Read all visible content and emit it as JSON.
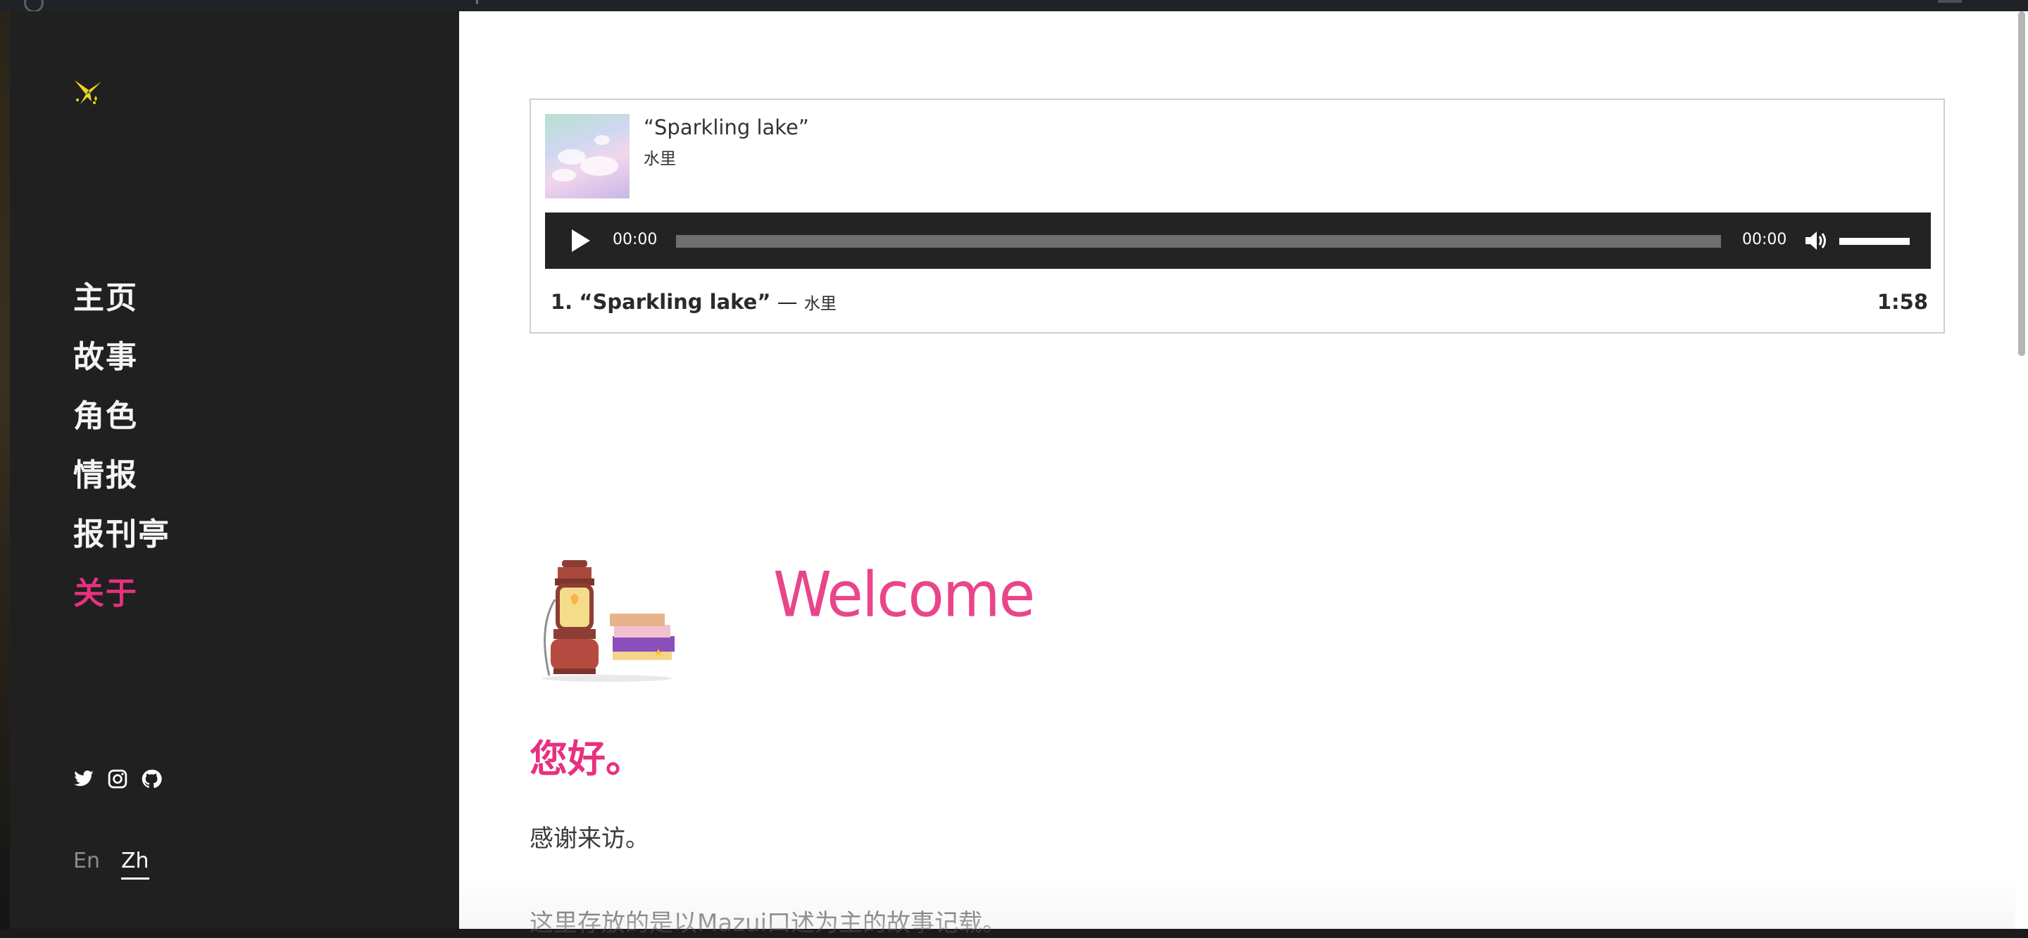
{
  "sidebar": {
    "nav": [
      {
        "label": "主页"
      },
      {
        "label": "故事"
      },
      {
        "label": "角色"
      },
      {
        "label": "情报"
      },
      {
        "label": "报刊亭"
      },
      {
        "label": "关于",
        "active": true
      }
    ],
    "social_icons": [
      "twitter-icon",
      "instagram-icon",
      "github-icon"
    ],
    "languages": {
      "en": "En",
      "zh": "Zh",
      "selected": "Zh"
    }
  },
  "player": {
    "title": "“Sparkling lake”",
    "artist": "水里",
    "current_time": "00:00",
    "duration": "00:00",
    "playlist": [
      {
        "number": "1.",
        "name": "“Sparkling lake”",
        "separator": "—",
        "artist": "水里",
        "length": "1:58"
      }
    ]
  },
  "content": {
    "welcome": "Welcome",
    "greeting": "您好。",
    "paragraph_1": "感谢来访。",
    "paragraph_2": "这里存放的是以Mazui口述为主的故事记载。"
  },
  "colors": {
    "accent": "#e7317f",
    "sidebar_bg": "#202020",
    "player_bar": "#232323"
  }
}
